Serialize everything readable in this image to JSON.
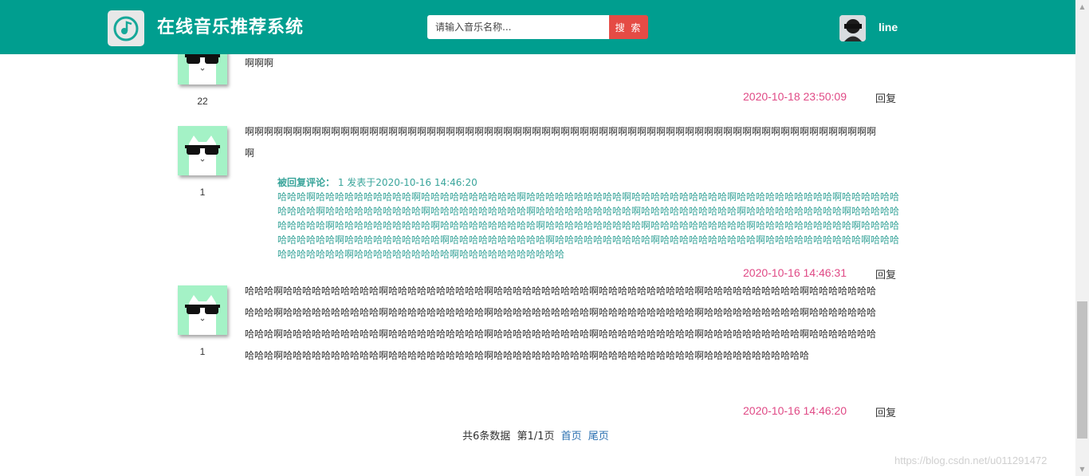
{
  "header": {
    "title": "在线音乐推荐系统",
    "search_placeholder": "请输入音乐名称...",
    "search_button": "搜 索",
    "username": "line"
  },
  "comments": [
    {
      "likes": "22",
      "text": "啊啊啊",
      "time": "2020-10-18 23:50:09",
      "reply_label": "回复"
    },
    {
      "likes": "1",
      "text": "啊啊啊啊啊啊啊啊啊啊啊啊啊啊啊啊啊啊啊啊啊啊啊啊啊啊啊啊啊啊啊啊啊啊啊啊啊啊啊啊啊啊啊啊啊啊啊啊啊啊啊啊啊啊啊啊啊啊啊啊啊啊啊啊啊啊啊",
      "quoted": {
        "label": "被回复评论：",
        "meta": "1 发表于2020-10-16 14:46:20",
        "text": "哈哈哈啊哈哈哈哈哈哈哈哈哈哈啊哈哈哈哈哈哈哈哈哈哈啊哈哈哈哈哈哈哈哈哈哈啊哈哈哈哈哈哈哈哈哈哈啊哈哈哈哈哈哈哈哈哈哈啊哈哈哈哈哈哈哈哈哈哈啊哈哈哈哈哈哈哈哈哈哈啊哈哈哈哈哈哈哈哈哈哈啊哈哈哈哈哈哈哈哈哈哈啊哈哈哈哈哈哈哈哈哈哈啊哈哈哈哈哈哈哈哈哈哈啊哈哈哈哈哈哈哈哈哈哈啊哈哈哈哈哈哈哈哈哈哈啊哈哈哈哈哈哈哈哈哈哈啊哈哈哈哈哈哈哈哈哈哈啊哈哈哈哈哈哈哈哈哈哈啊哈哈哈哈哈哈哈哈哈哈啊哈哈哈哈哈哈哈哈哈哈啊哈哈哈哈哈哈哈哈哈哈啊哈哈哈哈哈哈哈哈哈哈啊哈哈哈哈哈哈哈哈哈哈啊哈哈哈哈哈哈哈哈哈哈啊哈哈哈哈哈哈哈哈哈哈啊哈哈哈哈哈哈哈哈哈哈啊哈哈哈哈哈哈哈哈哈哈啊哈哈哈哈哈哈哈哈哈哈哈"
      },
      "time": "2020-10-16 14:46:31",
      "reply_label": "回复"
    },
    {
      "likes": "1",
      "text": "哈哈哈啊哈哈哈哈哈哈哈哈哈哈啊哈哈哈哈哈哈哈哈哈哈啊哈哈哈哈哈哈哈哈哈哈啊哈哈哈哈哈哈哈哈哈哈啊哈哈哈哈哈哈哈哈哈哈啊哈哈哈哈哈哈哈哈哈哈啊哈哈哈哈哈哈哈哈哈哈啊哈哈哈哈哈哈哈哈哈哈啊哈哈哈哈哈哈哈哈哈哈啊哈哈哈哈哈哈哈哈哈哈啊哈哈哈哈哈哈哈哈哈哈啊哈哈哈哈哈哈哈哈哈哈啊哈哈哈哈哈哈哈哈哈哈啊哈哈哈哈哈哈哈哈哈哈啊哈哈哈哈哈哈哈哈哈哈啊哈哈哈哈哈哈哈哈哈哈啊哈哈哈哈哈哈哈哈哈哈啊哈哈哈哈哈哈哈哈哈哈啊哈哈哈哈哈哈哈哈哈哈啊哈哈哈哈哈哈哈哈哈哈啊哈哈哈哈哈哈哈哈哈哈啊哈哈哈哈哈哈哈哈哈哈啊哈哈哈哈哈哈哈哈哈哈哈",
      "time": "2020-10-16 14:46:20",
      "reply_label": "回复"
    }
  ],
  "pagination": {
    "summary": "共6条数据  第1/1页",
    "first": "首页",
    "last": "尾页"
  },
  "watermark": "https://blog.csdn.net/u011291472"
}
